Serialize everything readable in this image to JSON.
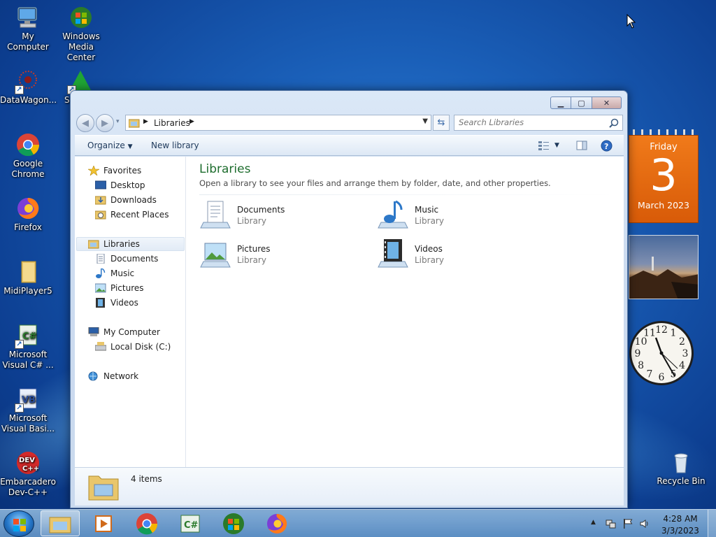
{
  "desktop": {
    "icons": [
      {
        "label_lines": [
          "My Computer"
        ]
      },
      {
        "label_lines": [
          "Windows",
          "Media Center"
        ]
      },
      {
        "label_lines": [
          "DataWagon..."
        ]
      },
      {
        "label_lines": [
          "S"
        ]
      },
      {
        "label_lines": [
          "Google",
          "Chrome"
        ]
      },
      {
        "label_lines": [
          "Firefox"
        ]
      },
      {
        "label_lines": [
          "MidiPlayer5"
        ]
      },
      {
        "label_lines": [
          "Microsoft",
          "Visual C# ..."
        ]
      },
      {
        "label_lines": [
          "Microsoft",
          "Visual Basi..."
        ]
      },
      {
        "label_lines": [
          "Embarcadero",
          "Dev-C++"
        ]
      },
      {
        "label_lines": [
          "Recycle Bin"
        ]
      }
    ]
  },
  "window": {
    "address": {
      "root_label": "Libraries"
    },
    "search": {
      "placeholder": "Search Libraries"
    },
    "toolbar": {
      "organize_label": "Organize",
      "new_library_label": "New library"
    },
    "nav": {
      "favorites": "Favorites",
      "desktop": "Desktop",
      "downloads": "Downloads",
      "recent_places": "Recent Places",
      "libraries": "Libraries",
      "documents": "Documents",
      "music": "Music",
      "pictures": "Pictures",
      "videos": "Videos",
      "my_computer": "My Computer",
      "local_disk": "Local Disk (C:)",
      "network": "Network"
    },
    "main": {
      "title": "Libraries",
      "subtitle": "Open a library to see your files and arrange them by folder, date, and other properties.",
      "items": [
        {
          "name": "Documents",
          "type": "Library",
          "icon": "documents-library-icon"
        },
        {
          "name": "Music",
          "type": "Library",
          "icon": "music-library-icon"
        },
        {
          "name": "Pictures",
          "type": "Library",
          "icon": "pictures-library-icon"
        },
        {
          "name": "Videos",
          "type": "Library",
          "icon": "videos-library-icon"
        }
      ]
    },
    "details": {
      "count": "4 items"
    }
  },
  "gadgets": {
    "calendar": {
      "weekday": "Friday",
      "day": "3",
      "month_year": "March 2023"
    },
    "clock": {
      "numerals": [
        "12",
        "1",
        "2",
        "3",
        "4",
        "5",
        "6",
        "7",
        "8",
        "9",
        "10",
        "11"
      ]
    }
  },
  "taskbar": {
    "time": "4:28 AM",
    "date": "3/3/2023",
    "pinned": [
      "file-explorer-icon",
      "media-player-icon",
      "chrome-icon",
      "visual-csharp-icon",
      "windows-media-center-icon",
      "firefox-icon"
    ]
  },
  "colors": {
    "library_title": "#1e6d2e",
    "calendar_orange": "#e8690f",
    "desktop_blue": "#1a5fb8"
  }
}
